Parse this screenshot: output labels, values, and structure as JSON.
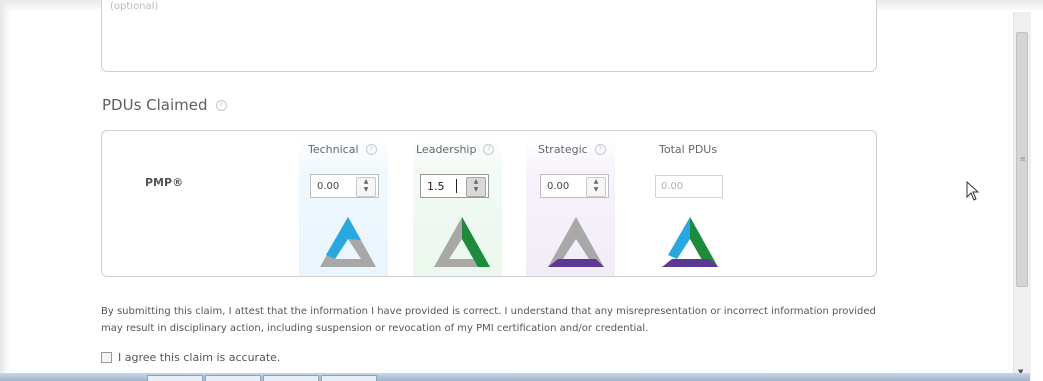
{
  "form": {
    "notes_placeholder": "(optional)",
    "pdus_section_title": "PDUs Claimed",
    "row_label": "PMP®",
    "columns": [
      {
        "key": "technical",
        "label": "Technical",
        "value": "0.00"
      },
      {
        "key": "leadership",
        "label": "Leadership",
        "value": "1.5"
      },
      {
        "key": "strategic",
        "label": "Strategic",
        "value": "0.00"
      }
    ],
    "total": {
      "label": "Total PDUs",
      "value": "0.00"
    },
    "disclaimer": "By submitting this claim, I attest that the information I have provided is correct. I understand that any misrepresentation or incorrect information provided may result in disciplinary action, including suspension or revocation of my PMI certification and/or credential.",
    "agree_label": "I agree this claim is accurate.",
    "agree_checked": false
  },
  "icons": {
    "help": "help-circle-icon",
    "triangle": "talent-triangle-icon",
    "stepper": "spinner-arrows-icon",
    "cursor": "mouse-pointer-icon"
  },
  "colors": {
    "technical": "#29a8e0",
    "leadership": "#1e8a3c",
    "strategic": "#5b3a96",
    "inactive": "#a4a4a4"
  }
}
